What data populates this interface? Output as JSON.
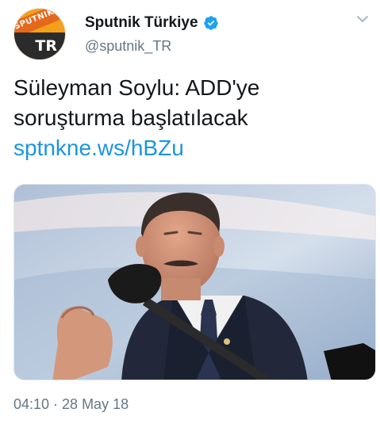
{
  "tweet": {
    "author": {
      "display_name": "Sputnik Türkiye",
      "handle": "@sputnik_TR",
      "verified": true,
      "avatar": {
        "logo_text": "SPUTNIK",
        "badge_text": "TR",
        "colors": {
          "orange": "#f5a01a",
          "dark": "#2b2b2b"
        }
      }
    },
    "text_lines": [
      "Süleyman Soylu: ADD'ye",
      "soruşturma başlatılacak"
    ],
    "link": "sptnkne.ws/hBZu",
    "media": {
      "icon": "photo",
      "description_icon": "speaker-at-microphone-photo"
    },
    "timestamp": "04:10 · 28 May 18"
  },
  "icons": {
    "verified": "verified-badge-icon",
    "menu": "chevron-down-icon"
  },
  "colors": {
    "link": "#1b95e0",
    "secondary_text": "#657786",
    "verified": "#1da1f2"
  }
}
